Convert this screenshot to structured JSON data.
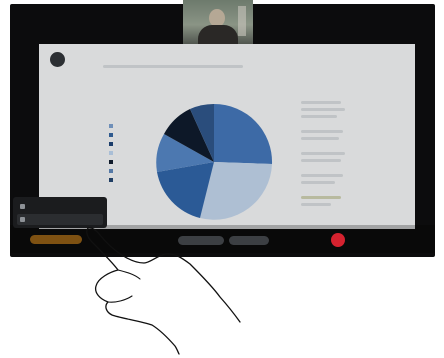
{
  "device": {
    "screen_bg": "#0c0c0d"
  },
  "self_view": {
    "kind": "camera-self-view"
  },
  "slide": {
    "logo_text": "",
    "title": "",
    "legend": [
      {
        "label": "",
        "color": "#6f8fb8"
      },
      {
        "label": "",
        "color": "#2f5a8f"
      },
      {
        "label": "",
        "color": "#1b3d6b"
      },
      {
        "label": "",
        "color": "#a9bed6"
      },
      {
        "label": "",
        "color": "#101b2b"
      },
      {
        "label": "",
        "color": "#5579a6"
      },
      {
        "label": "",
        "color": "#203e64"
      }
    ]
  },
  "controls": {
    "share_pill": "",
    "pill_a": "",
    "pill_b": "",
    "pill_c": "",
    "end_call_color": "#d5222f"
  },
  "popup": {
    "items": [
      {
        "label": "",
        "icon": "screen-share-icon"
      },
      {
        "label": "",
        "icon": "stop-share-icon"
      }
    ]
  }
}
